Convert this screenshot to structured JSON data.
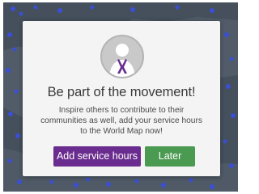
{
  "modal": {
    "headline": "Be part of the movement!",
    "message": "Inspire others to contribute to their communities as well, add your service hours to the World Map now!",
    "primary_button": "Add service hours",
    "secondary_button": "Later"
  },
  "colors": {
    "primary": "#6a2c8e",
    "secondary": "#4a9a52",
    "map_background": "#45505c",
    "map_pin": "#3b4fd6"
  },
  "icons": {
    "avatar": "ribbon-icon"
  }
}
